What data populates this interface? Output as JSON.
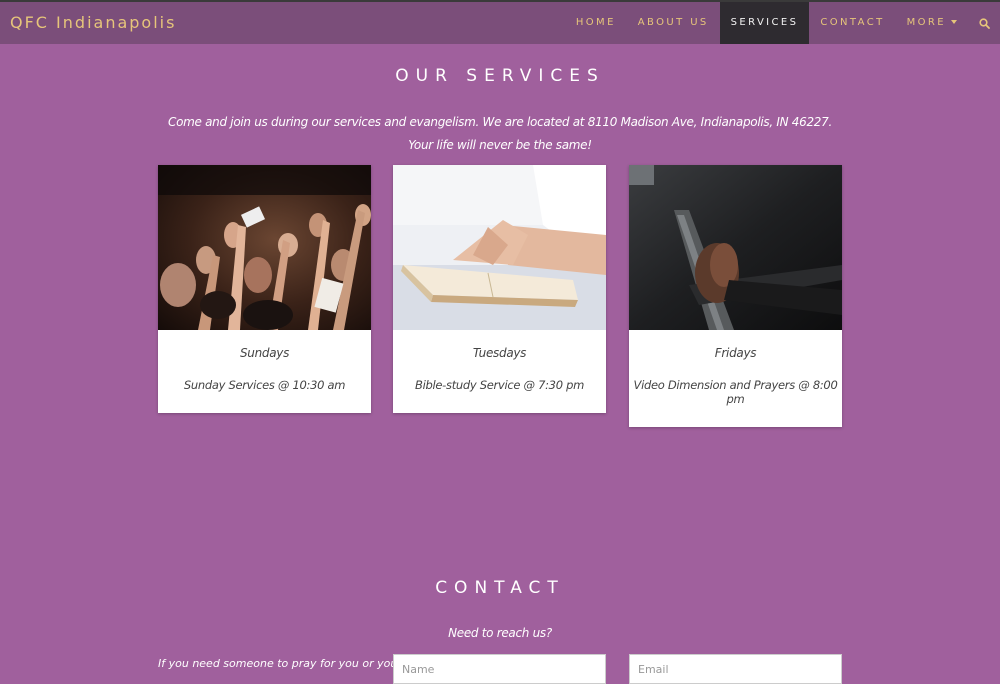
{
  "nav": {
    "brand": "QFC Indianapolis",
    "items": [
      {
        "label": "HOME",
        "active": false
      },
      {
        "label": "ABOUT US",
        "active": false
      },
      {
        "label": "SERVICES",
        "active": true
      },
      {
        "label": "CONTACT",
        "active": false
      },
      {
        "label": "MORE",
        "active": false
      }
    ],
    "search_icon": "search-icon"
  },
  "services": {
    "title": "OUR SERVICES",
    "intro_line1": "Come and join us during our services and evangelism. We are located at 8110 Madison Ave, Indianapolis, IN 46227.",
    "intro_line2": "Your life will never be the same!",
    "cards": [
      {
        "day": "Sundays",
        "detail": "Sunday Services @ 10:30 am",
        "image": "worship-crowd-photo"
      },
      {
        "day": "Tuesdays",
        "detail": "Bible-study Service @ 7:30 pm",
        "image": "praying-hands-bible-photo"
      },
      {
        "day": "Fridays",
        "detail": "Video Dimension and Prayers @ 8:00 pm",
        "image": "praying-hands-pew-photo"
      }
    ]
  },
  "contact": {
    "title": "CONTACT",
    "subtitle": "Need to reach us?",
    "left_text": "If you need someone to pray for you or you",
    "name_placeholder": "Name",
    "email_placeholder": "Email"
  },
  "colors": {
    "background": "#a0609d",
    "navbar": "#7b4e7a",
    "accent": "#e6c57a",
    "active_nav": "#2e2b30"
  }
}
